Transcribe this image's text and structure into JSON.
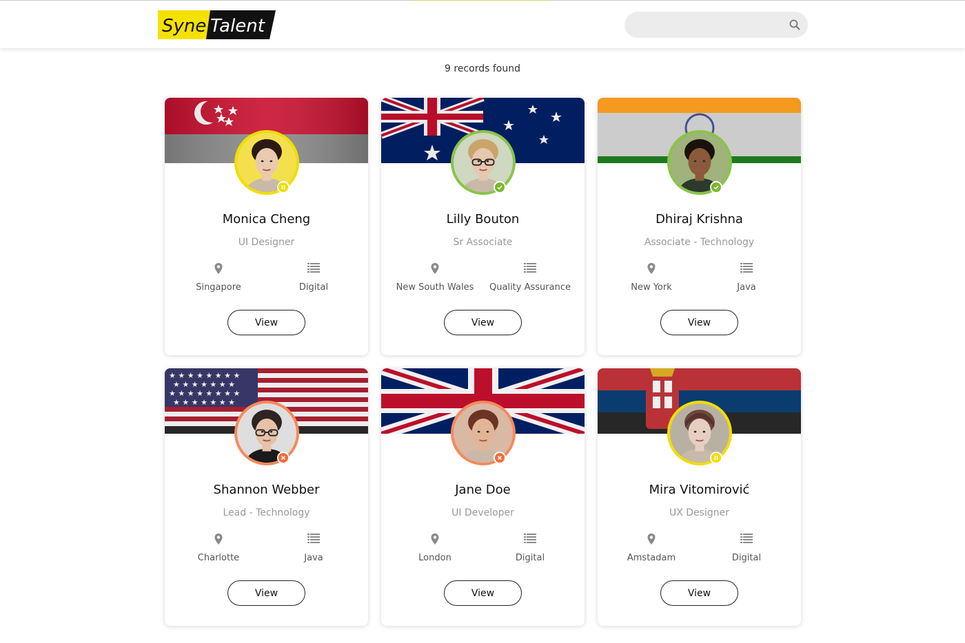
{
  "header": {
    "logo_text_1": "Syne",
    "logo_text_2": "Talent",
    "search": {
      "value": "",
      "placeholder": ""
    }
  },
  "records_found": "9 records found",
  "colors": {
    "brand_yellow": "#f5e100",
    "status_active": "#7cb82f",
    "status_paused": "#f0de00",
    "status_inactive": "#f26d3a"
  },
  "cards": [
    {
      "name": "Monica Cheng",
      "role": "UI Designer",
      "location": "Singapore",
      "department": "Digital",
      "flag": "singapore-flag",
      "status": "paused",
      "ring_color": "#f0de00",
      "view_label": "View"
    },
    {
      "name": "Lilly Bouton",
      "role": "Sr Associate",
      "location": "New South Wales",
      "department": "Quality Assurance",
      "flag": "australia-flag",
      "status": "active",
      "ring_color": "#8bc34a",
      "view_label": "View"
    },
    {
      "name": "Dhiraj Krishna",
      "role": "Associate - Technology",
      "location": "New York",
      "department": "Java",
      "flag": "india-flag",
      "status": "active",
      "ring_color": "#8bc34a",
      "view_label": "View"
    },
    {
      "name": "Shannon Webber",
      "role": "Lead - Technology",
      "location": "Charlotte",
      "department": "Java",
      "flag": "usa-flag",
      "status": "inactive",
      "ring_color": "#f58a5b",
      "view_label": "View"
    },
    {
      "name": "Jane Doe",
      "role": "UI Developer",
      "location": "London",
      "department": "Digital",
      "flag": "uk-flag",
      "status": "inactive",
      "ring_color": "#f58a5b",
      "view_label": "View"
    },
    {
      "name": "Mira Vitomirović",
      "role": "UX Designer",
      "location": "Amstadam",
      "department": "Digital",
      "flag": "serbia-flag",
      "status": "paused",
      "ring_color": "#f0de00",
      "view_label": "View"
    }
  ]
}
